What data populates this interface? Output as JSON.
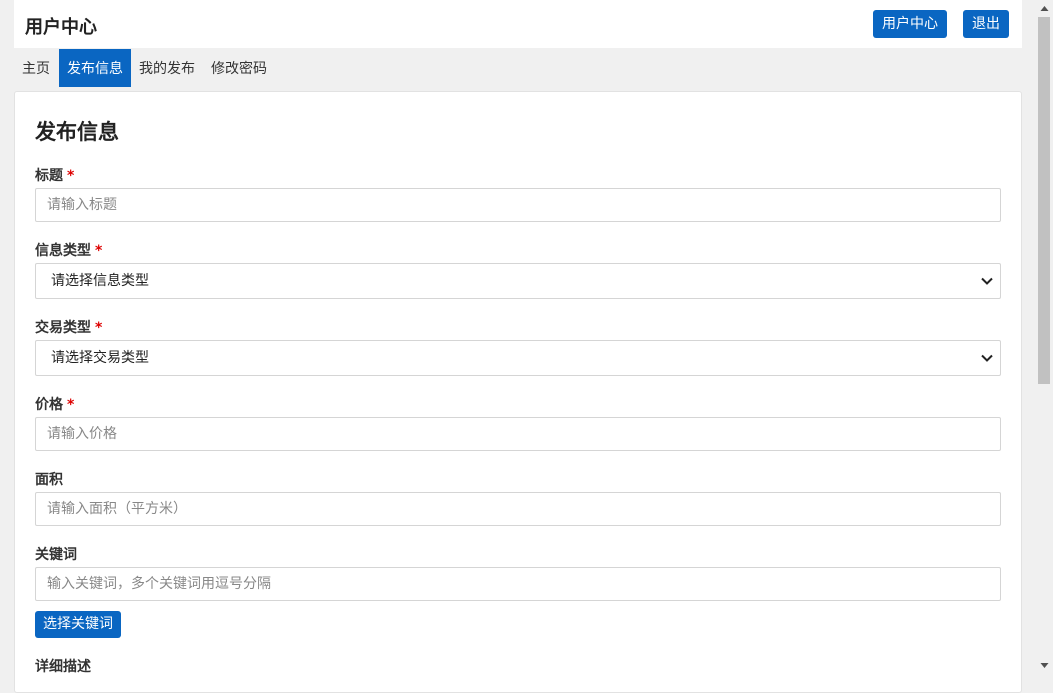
{
  "header": {
    "title": "用户中心",
    "user_center_label": "用户中心",
    "logout_label": "退出"
  },
  "nav": {
    "items": [
      {
        "label": "主页"
      },
      {
        "label": "发布信息"
      },
      {
        "label": "我的发布"
      },
      {
        "label": "修改密码"
      }
    ],
    "active_index": 1
  },
  "form": {
    "title": "发布信息",
    "required_mark": "*",
    "fields": {
      "title": {
        "label": "标题",
        "placeholder": "请输入标题"
      },
      "info_type": {
        "label": "信息类型",
        "selected": "请选择信息类型"
      },
      "trade_type": {
        "label": "交易类型",
        "selected": "请选择交易类型"
      },
      "price": {
        "label": "价格",
        "placeholder": "请输入价格"
      },
      "area": {
        "label": "面积",
        "placeholder": "请输入面积（平方米）"
      },
      "keywords": {
        "label": "关键词",
        "placeholder": "输入关键词，多个关键词用逗号分隔"
      },
      "description": {
        "label": "详细描述"
      }
    },
    "choose_keywords_label": "选择关键词"
  },
  "colors": {
    "accent": "#0a66c2",
    "required": "#dd0000"
  }
}
